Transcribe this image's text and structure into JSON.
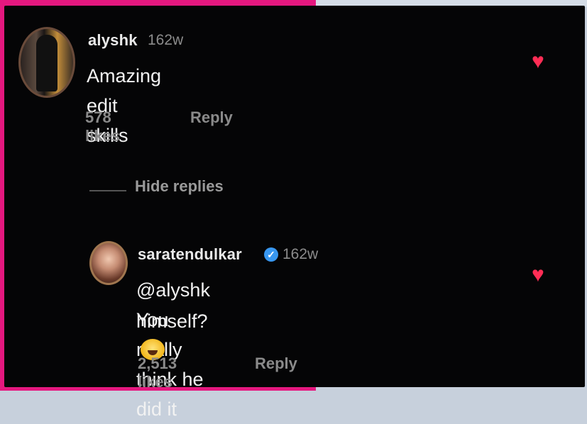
{
  "comments": [
    {
      "username": "alyshk",
      "time": "162w",
      "text": "Amazing edit skills",
      "likes": "578 likes",
      "reply": "Reply"
    },
    {
      "username": "saratendulkar",
      "verified": true,
      "time": "162w",
      "text_line1": "@alyshk You really think he did it",
      "text_line2": "himself?",
      "emoji": "laughing-face",
      "likes": "2,513 likes",
      "reply": "Reply"
    }
  ],
  "thread": {
    "hide_replies": "Hide replies"
  },
  "colors": {
    "background": "#050506",
    "heart": "#ff2d55",
    "verified": "#3897f0",
    "frame_pink": "#e5187f"
  }
}
